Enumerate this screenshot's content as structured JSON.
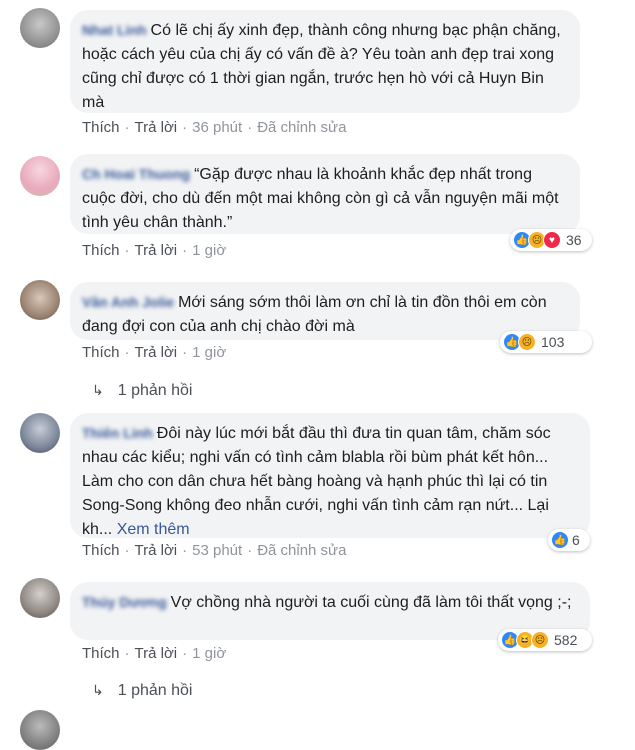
{
  "comments": [
    {
      "author": "Nhat Linh",
      "text": "Có lẽ chị ấy xinh đẹp, thành công nhưng bạc phận chăng, hoặc cách yêu của chị ấy có vấn đề à? Yêu toàn anh đẹp trai xong cũng chỉ được có 1 thời gian ngắn, trước hẹn hò với cả Huyn Bin mà",
      "like_label": "Thích",
      "reply_label": "Trả lời",
      "time": "36 phút",
      "edited": "Đã chỉnh sửa"
    },
    {
      "author": "Ch Hoai Thuong",
      "text": "“Gặp được nhau là khoảnh khắc đẹp nhất trong cuộc đời, cho dù đến một mai không còn gì cả vẫn nguyện mãi một tình yêu chân thành.”",
      "like_label": "Thích",
      "reply_label": "Trả lời",
      "time": "1 giờ",
      "reaction_icons": [
        "like-icon",
        "sad-icon",
        "love-icon"
      ],
      "reaction_count": "36"
    },
    {
      "author": "Vân Anh Jolie",
      "text": "Mới sáng sớm thôi làm ơn chỉ là tin đồn thôi em còn đang đợi con của anh chị chào đời mà",
      "like_label": "Thích",
      "reply_label": "Trả lời",
      "time": "1 giờ",
      "reaction_icons": [
        "like-icon",
        "sad-icon"
      ],
      "reaction_count": "103",
      "replies_label": "1 phản hồi"
    },
    {
      "author": "Thiên Linh",
      "text": "Đôi này lúc mới bắt đầu thì đưa tin quan tâm, chăm sóc nhau các kiểu; nghi vấn có tình cảm blabla rồi bùm phát kết hôn... Làm cho con dân chưa hết bàng hoàng và hạnh phúc thì lại có tin Song-Song không đeo nhẫn cưới, nghi vấn tình cảm rạn nứt... Lại kh...",
      "see_more": "Xem thêm",
      "like_label": "Thích",
      "reply_label": "Trả lời",
      "time": "53 phút",
      "edited": "Đã chỉnh sửa",
      "reaction_icons": [
        "like-icon"
      ],
      "reaction_count": "6"
    },
    {
      "author": "Thúy Dương",
      "text": "Vợ chồng nhà người ta cuối cùng đã làm tôi thất vọng ;-;",
      "like_label": "Thích",
      "reply_label": "Trả lời",
      "time": "1 giờ",
      "reaction_icons": [
        "like-icon",
        "haha-icon",
        "sad-icon"
      ],
      "reaction_count": "582",
      "replies_label": "1 phản hồi"
    }
  ],
  "colors": {
    "link": "#385898",
    "bubble": "#f2f3f5",
    "meta": "#90949c"
  }
}
